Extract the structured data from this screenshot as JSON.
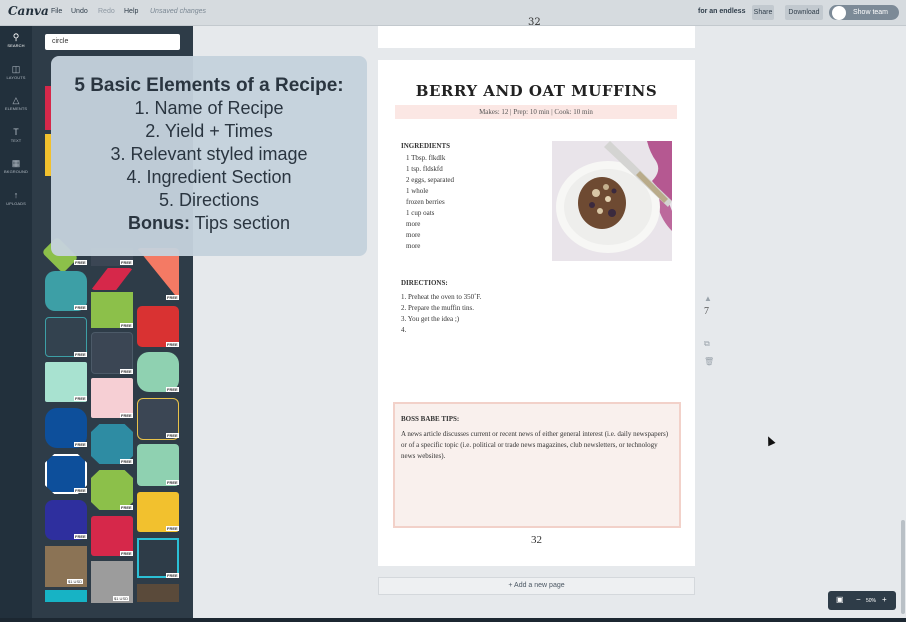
{
  "topbar": {
    "logo": "Canva",
    "menu": [
      "File",
      "Undo",
      "Redo",
      "Help"
    ],
    "unsaved": "Unsaved changes",
    "design_name": "for an endless",
    "share": "Share",
    "download": "Download",
    "show_team": "Show team"
  },
  "rail": [
    {
      "label": "SEARCH",
      "icon": "search-icon"
    },
    {
      "label": "LAYOUTS",
      "icon": "layouts-icon"
    },
    {
      "label": "ELEMENTS",
      "icon": "elements-icon"
    },
    {
      "label": "TEXT",
      "icon": "text-icon"
    },
    {
      "label": "BKGROUND",
      "icon": "background-icon"
    },
    {
      "label": "UPLOADS",
      "icon": "upload-icon"
    }
  ],
  "panel": {
    "search_value": "circle",
    "free_label": "FREE",
    "price_label": "$1 USD",
    "tile_colors": [
      "#3d9fa6",
      "#8cc04a",
      "#d93232",
      "#33424f",
      "#3b4654",
      "#8fd1b1",
      "#a8e2d0",
      "#f6cfd4",
      "#8fd1b1",
      "#0d4f9b",
      "#2e8ca3",
      "#3a4754",
      "#0d4f9b",
      "#8cc04a",
      "#8fd1b1",
      "#2e2f9e",
      "#d6284a",
      "#f2c12e"
    ]
  },
  "overlay": {
    "title": "5 Basic Elements of a Recipe:",
    "items": [
      "1. Name of Recipe",
      "2. Yield + Times",
      "3. Relevant styled image",
      "4. Ingredient Section",
      "5. Directions"
    ],
    "bonus_label": "Bonus:",
    "bonus_text": " Tips section"
  },
  "prev_page_number": "32",
  "recipe": {
    "title": "BERRY AND OAT MUFFINS",
    "makes": "Makes: 12 | Prep: 10 min | Cook: 10 min",
    "ingredients_heading": "INGREDIENTS",
    "ingredients": [
      "1 Tbsp. flkdlk",
      "1 tsp. fldskfd",
      "2 eggs, separated",
      "1 whole",
      "frozen berries",
      "1 cup oats",
      "more",
      "more",
      "more"
    ],
    "directions_heading": "DIRECTIONS:",
    "directions": [
      "1. Preheat the oven to 350˚F.",
      "2. Prepare the muffin tins.",
      "3. You get the idea ;)",
      "4."
    ],
    "tips_heading": "BOSS BABE TIPS:",
    "tips_body": "A news article discusses current or recent news of either general interest (i.e. daily newspapers) or of a specific topic (i.e. political or trade news magazines, club newsletters, or technology news websites).",
    "page_number": "32"
  },
  "side_page_number": "7",
  "add_page": "+ Add a new page",
  "zoom": "50%"
}
